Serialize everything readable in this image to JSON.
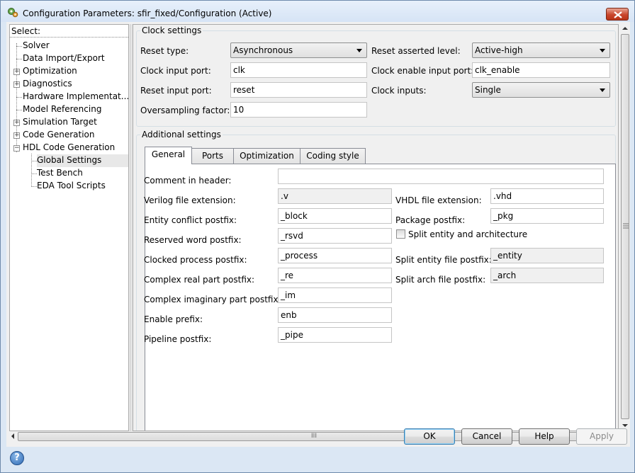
{
  "window": {
    "title": "Configuration Parameters: sfir_fixed/Configuration (Active)"
  },
  "tree": {
    "header": "Select:",
    "items": [
      {
        "label": "Solver"
      },
      {
        "label": "Data Import/Export"
      },
      {
        "label": "Optimization"
      },
      {
        "label": "Diagnostics"
      },
      {
        "label": "Hardware Implementat..."
      },
      {
        "label": "Model Referencing"
      },
      {
        "label": "Simulation Target"
      },
      {
        "label": "Code Generation"
      },
      {
        "label": "HDL Code Generation"
      },
      {
        "label": "Global Settings"
      },
      {
        "label": "Test Bench"
      },
      {
        "label": "EDA Tool Scripts"
      }
    ]
  },
  "clock": {
    "title": "Clock settings",
    "reset_type_label": "Reset type:",
    "reset_type_value": "Asynchronous",
    "reset_level_label": "Reset asserted level:",
    "reset_level_value": "Active-high",
    "clock_input_label": "Clock input port:",
    "clock_input_value": "clk",
    "clock_enable_label": "Clock enable input port:",
    "clock_enable_value": "clk_enable",
    "reset_input_label": "Reset input port:",
    "reset_input_value": "reset",
    "clock_inputs_label": "Clock inputs:",
    "clock_inputs_value": "Single",
    "oversampling_label": "Oversampling factor:",
    "oversampling_value": "10"
  },
  "additional": {
    "title": "Additional settings",
    "tabs": [
      {
        "label": "General"
      },
      {
        "label": "Ports"
      },
      {
        "label": "Optimization"
      },
      {
        "label": "Coding style"
      }
    ],
    "general": {
      "comment_label": "Comment in header:",
      "comment_value": "",
      "verilog_ext_label": "Verilog file extension:",
      "verilog_ext_value": ".v",
      "vhdl_ext_label": "VHDL file extension:",
      "vhdl_ext_value": ".vhd",
      "entity_conflict_label": "Entity conflict postfix:",
      "entity_conflict_value": "_block",
      "package_label": "Package postfix:",
      "package_value": "_pkg",
      "reserved_label": "Reserved word postfix:",
      "reserved_value": "_rsvd",
      "split_entity_label": "Split entity and architecture",
      "split_entity_checked": false,
      "clocked_label": "Clocked process postfix:",
      "clocked_value": "_process",
      "split_entity_file_label": "Split entity file postfix:",
      "split_entity_file_value": "_entity",
      "complex_real_label": "Complex real part postfix:",
      "complex_real_value": "_re",
      "split_arch_label": "Split arch file postfix:",
      "split_arch_value": "_arch",
      "complex_imag_label": "Complex imaginary part postfix:",
      "complex_imag_value": "_im",
      "enable_prefix_label": "Enable prefix:",
      "enable_prefix_value": "enb",
      "pipeline_label": "Pipeline postfix:",
      "pipeline_value": "_pipe"
    }
  },
  "buttons": {
    "ok": "OK",
    "cancel": "Cancel",
    "help": "Help",
    "apply": "Apply"
  },
  "scroll_grip": "III",
  "help_glyph": "?"
}
